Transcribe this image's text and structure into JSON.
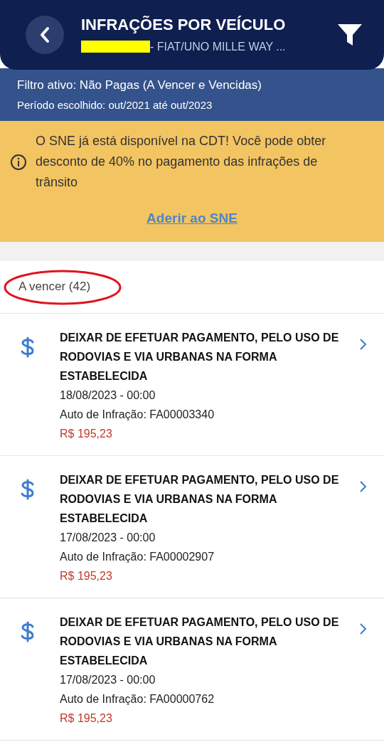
{
  "header": {
    "title": "INFRAÇÕES POR VEÍCULO",
    "subtitle": "- FIAT/UNO MILLE WAY ...",
    "redacted": true
  },
  "filter": {
    "active": "Filtro ativo: Não Pagas (A Vencer e Vencidas)",
    "period": "Período escolhido: out/2021 até out/2023"
  },
  "alert": {
    "text": "O SNE já está disponível na CDT! Você pode obter desconto de 40% no pagamento das infrações de trânsito",
    "link": "Aderir ao SNE"
  },
  "section": {
    "title": "A vencer (42)",
    "circled": true
  },
  "items": [
    {
      "title": "DEIXAR DE EFETUAR PAGAMENTO, PELO USO DE RODOVIAS E VIA URBANAS NA FORMA ESTABELECIDA",
      "date": "18/08/2023 - 00:00",
      "auto": "Auto de Infração: FA00003340",
      "amount": "R$ 195,23"
    },
    {
      "title": "DEIXAR DE EFETUAR PAGAMENTO, PELO USO DE RODOVIAS E VIA URBANAS NA FORMA ESTABELECIDA",
      "date": "17/08/2023 - 00:00",
      "auto": "Auto de Infração: FA00002907",
      "amount": "R$ 195,23"
    },
    {
      "title": "DEIXAR DE EFETUAR PAGAMENTO, PELO USO DE RODOVIAS E VIA URBANAS NA FORMA ESTABELECIDA",
      "date": "17/08/2023 - 00:00",
      "auto": "Auto de Infração: FA00000762",
      "amount": "R$ 195,23"
    }
  ]
}
